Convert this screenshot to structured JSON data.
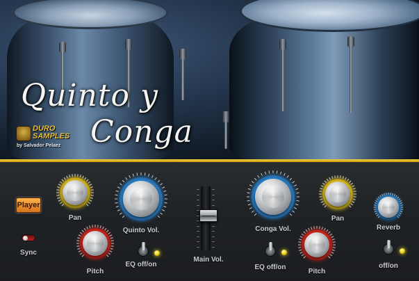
{
  "header": {
    "title_line1": "Quinto y",
    "title_line2": "Conga",
    "logo_line1": "DURO",
    "logo_line2": "SAMPLES",
    "byline": "by Salvador Pelaez"
  },
  "left_section": {
    "player_button": "Player",
    "sync_label": "Sync",
    "pan_label": "Pan",
    "pitch_label": "Pitch",
    "volume_label": "Quinto Vol.",
    "eq_label": "EQ off/on"
  },
  "center_section": {
    "main_volume_label": "Main Vol.",
    "main_volume_level": 0.55
  },
  "right_section": {
    "volume_label": "Conga Vol.",
    "pan_label": "Pan",
    "reverb_label": "Reverb",
    "eq_label": "EQ off/on",
    "pitch_label": "Pitch",
    "reverb_switch_label": "off/on"
  },
  "colors": {
    "accent_gold": "#f1d30e",
    "pan_ring": "#e3c21c",
    "pitch_ring": "#d8261c",
    "volume_ring": "#2a86d4",
    "reverb_ring": "#2a86d4",
    "player_button": "#f29a34"
  }
}
